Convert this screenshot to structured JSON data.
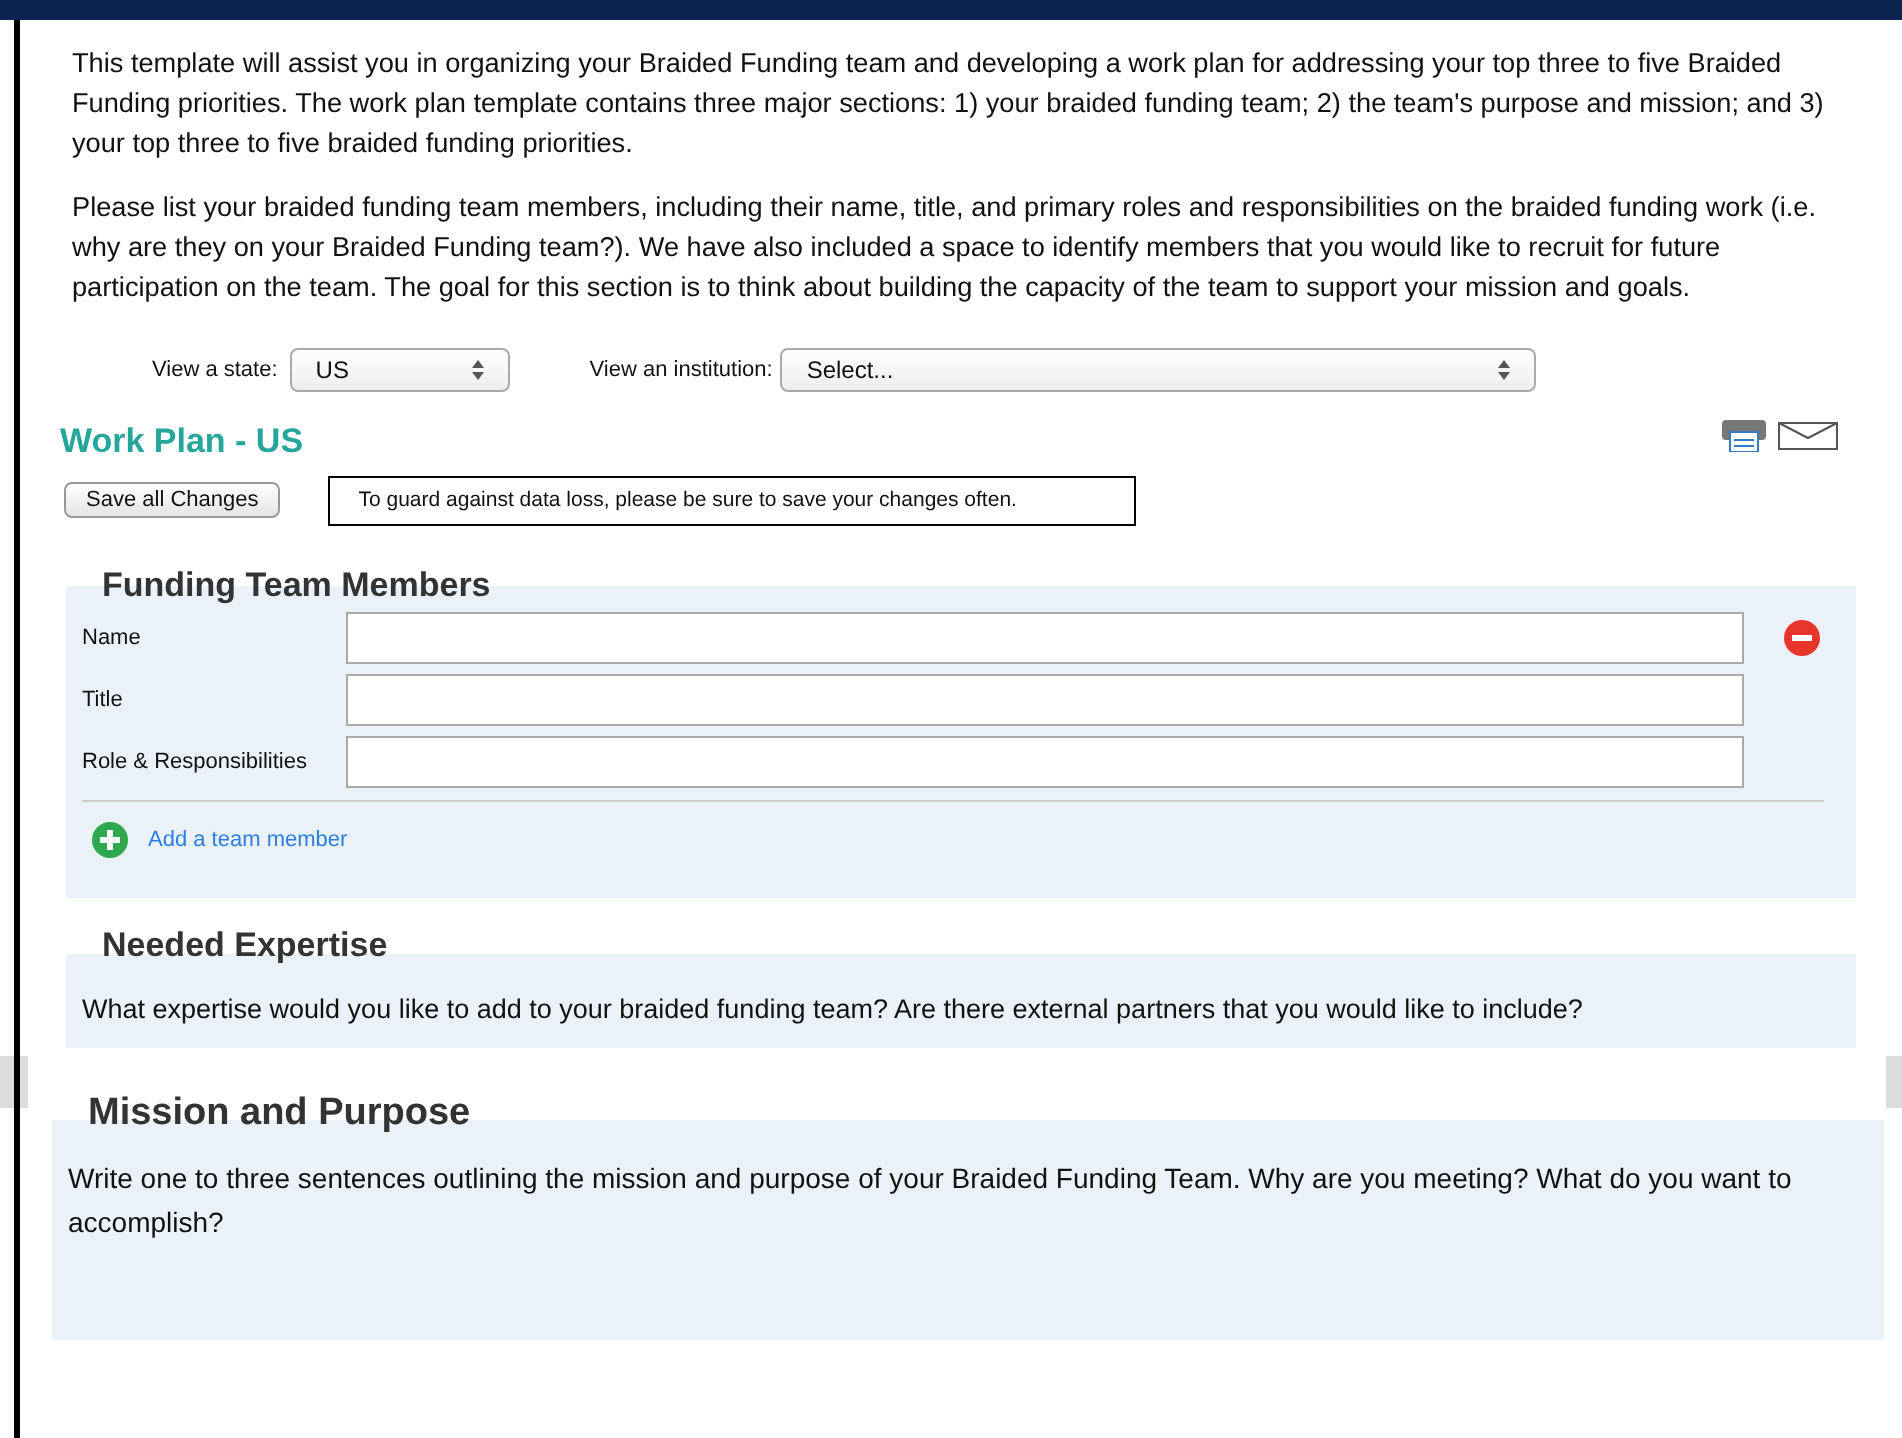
{
  "intro": [
    "This template will assist you in organizing your Braided Funding team and developing a work plan for addressing your top three to five Braided Funding priorities. The work plan template contains three major sections: 1) your braided funding team; 2) the team's purpose and mission; and 3) your top three to five braided funding priorities.",
    "Please list your braided funding team members, including their name, title, and primary roles and responsibilities on the braided funding work (i.e. why are they on your Braided Funding team?). We have also included a space to identify members that you would like to recruit for future participation on the team. The goal for this section is to think about building the capacity of the team to support your mission and goals."
  ],
  "filters": [
    {
      "label": "View a state:",
      "value": "US",
      "wide": false
    },
    {
      "label": "View an institution:",
      "value": "Select...",
      "wide": true
    }
  ],
  "title": "Work Plan - US",
  "save_button": "Save all Changes",
  "notice": "To guard against data loss, please be sure to save your changes often.",
  "team": {
    "heading": "Funding Team Members",
    "fields": [
      {
        "label": "Name",
        "removable": true
      },
      {
        "label": "Title",
        "removable": false
      },
      {
        "label": "Role & Responsibilities",
        "removable": false
      }
    ],
    "add_link": "Add a team member"
  },
  "expertise": {
    "heading": "Needed Expertise",
    "prompt": "What expertise would you like to add to your braided funding team? Are there external partners that you would like to include?"
  },
  "mission": {
    "heading": "Mission and Purpose",
    "prompt": "Write one to three sentences outlining the mission and purpose of your Braided Funding Team. Why are you meeting? What do you want to accomplish?"
  }
}
